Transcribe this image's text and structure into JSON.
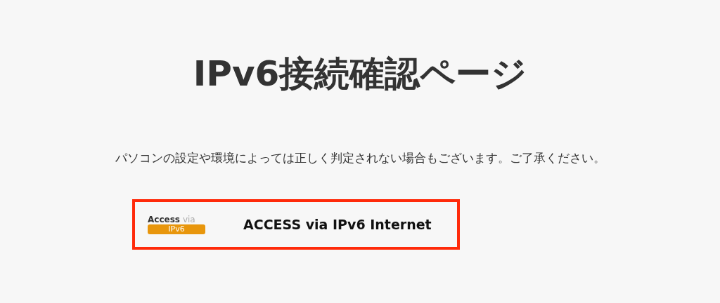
{
  "title": "IPv6接続確認ページ",
  "notice": "パソコンの設定や環境によっては正しく判定されない場合もございます。ご了承ください。",
  "result": {
    "badge": {
      "word_1": "Access",
      "word_2": "via",
      "tag": "IPv6"
    },
    "message": "ACCESS via IPv6 Internet"
  }
}
